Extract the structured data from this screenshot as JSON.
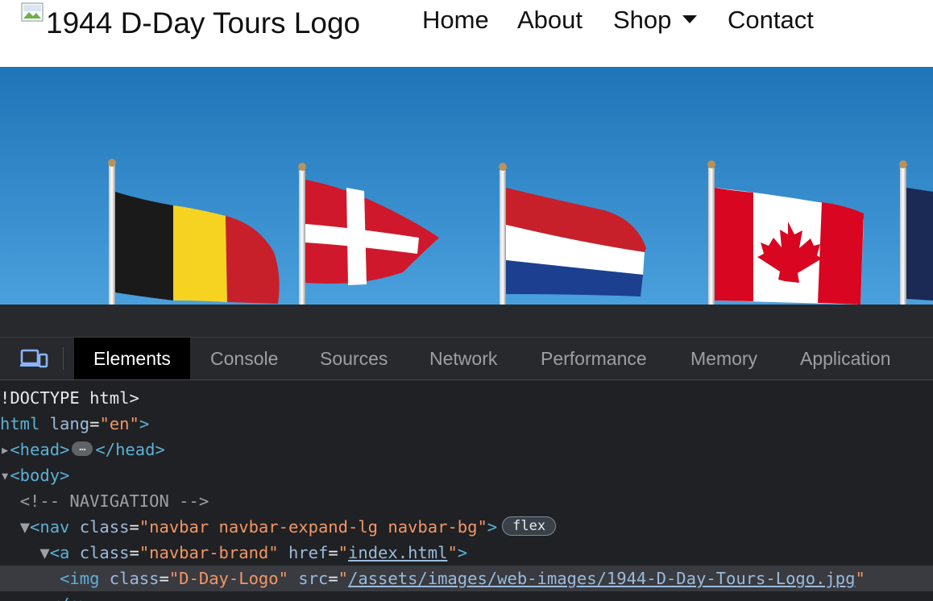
{
  "navbar": {
    "brand_alt": "1944 D-Day Tours Logo",
    "links": [
      {
        "label": "Home"
      },
      {
        "label": "About"
      },
      {
        "label": "Shop"
      },
      {
        "label": "Contact"
      }
    ]
  },
  "hero": {
    "flags": [
      "belgium",
      "denmark",
      "netherlands",
      "canada"
    ]
  },
  "devtools": {
    "tabs": [
      "Elements",
      "Console",
      "Sources",
      "Network",
      "Performance",
      "Memory",
      "Application"
    ],
    "active_tab": "Elements",
    "code": {
      "l1": "!DOCTYPE html>",
      "l2_tag": "html",
      "l2_attr": "lang",
      "l2_val": "\"en\"",
      "l3_open": "<head>",
      "l3_ellipsis": "…",
      "l3_close": "</head>",
      "l4": "<body>",
      "l5": "<!-- NAVIGATION -->",
      "l6_tag": "<nav",
      "l6_attr": "class",
      "l6_val": "\"navbar navbar-expand-lg navbar-bg\"",
      "l6_badge": "flex",
      "l7_tag": "<a",
      "l7_attr1": "class",
      "l7_val1": "\"navbar-brand\"",
      "l7_attr2": "href",
      "l7_link": "index.html",
      "l8_tag": "<img",
      "l8_attr1": "class",
      "l8_val1": "\"D-Day-Logo\"",
      "l8_attr2": "src",
      "l8_link": "/assets/images/web-images/1944-D-Day-Tours-Logo.jpg",
      "l9": "</a>"
    }
  },
  "colors": {
    "devtools_bg": "#202124",
    "tag": "#5db0d7",
    "attr": "#9bbbdc",
    "value": "#f29766",
    "sky": "#2f86c8"
  }
}
